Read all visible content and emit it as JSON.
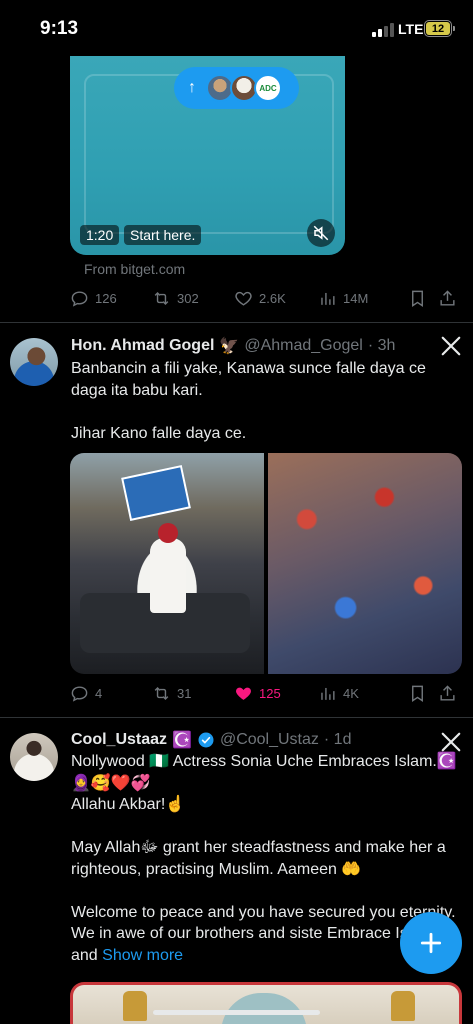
{
  "status_bar": {
    "time": "9:13",
    "network": "LTE",
    "battery": "12"
  },
  "tweet1": {
    "new_posts_badge": "ADC",
    "video_duration": "1:20",
    "video_cta": "Start here.",
    "source": "From bitget.com",
    "replies": "126",
    "reposts": "302",
    "likes": "2.6K",
    "views": "14M"
  },
  "tweet2": {
    "name": "Hon. Ahmad Gogel",
    "name_emoji": "🦅",
    "handle": "@Ahmad_Gogel",
    "time": "· 3h",
    "text": "Banbancin a fili yake, Kanawa sunce falle daya ce daga ita babu kari.\n\nJihar Kano falle daya ce.",
    "replies": "4",
    "reposts": "31",
    "likes": "125",
    "views": "4K"
  },
  "tweet3": {
    "name": "Cool_Ustaaz",
    "name_emoji": "☪️",
    "handle": "@Cool_Ustaz",
    "time": "· 1d",
    "text": "Nollywood 🇳🇬 Actress Sonia Uche Embraces Islam.☪️🧕🥰❤️💞\nAllahu Akbar!☝️\n\nMay Allahﷻ grant her steadfastness and make her a righteous, practising Muslim. Aameen 🤲\n\nWelcome to peace and you have secured you eternity. We in awe of our brothers and siste Embrace Islam and ",
    "show_more": "Show more"
  },
  "colors": {
    "accent": "#1d9bf0",
    "like": "#f91880",
    "muted": "#71767b",
    "background": "#000000"
  }
}
